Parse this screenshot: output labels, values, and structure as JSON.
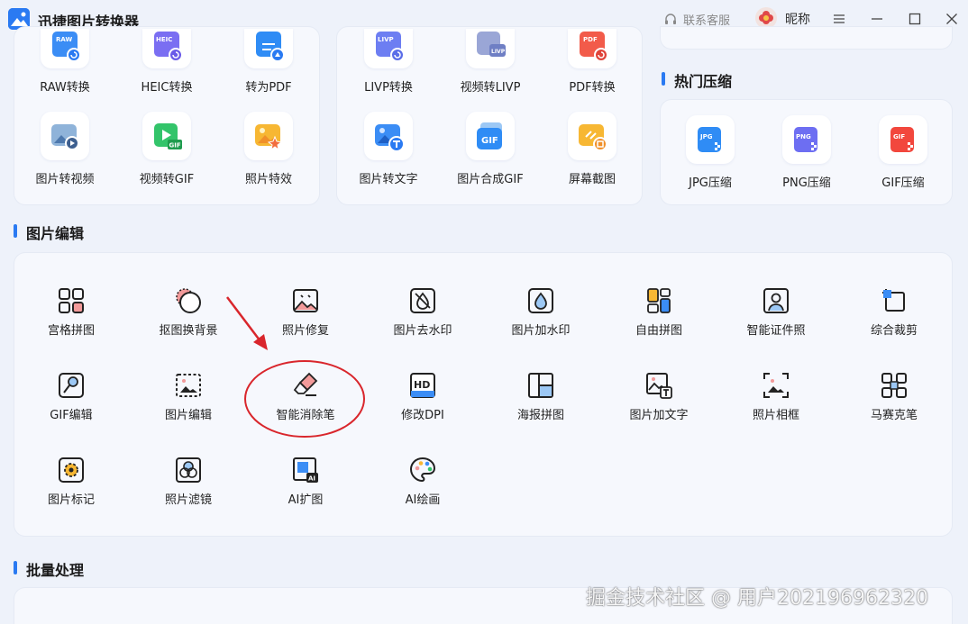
{
  "app": {
    "title": "迅捷图片转换器"
  },
  "header": {
    "support_label": "联系客服",
    "nickname": "昵称"
  },
  "convert_panel_left": {
    "row1": [
      "RAW转换",
      "HEIC转换",
      "转为PDF"
    ],
    "row1_badges": [
      "RAW",
      "HEIC",
      ""
    ],
    "row2": [
      "图片转视频",
      "视频转GIF",
      "照片特效"
    ],
    "row2_badges": [
      "",
      "GIF",
      ""
    ]
  },
  "convert_panel_mid": {
    "row1": [
      "LIVP转换",
      "视频转LIVP",
      "PDF转换"
    ],
    "row1_badges": [
      "LIVP",
      "LIVP",
      "PDF"
    ],
    "row2": [
      "图片转文字",
      "图片合成GIF",
      "屏幕截图"
    ],
    "row2_badges": [
      "",
      "GIF",
      ""
    ]
  },
  "hot_compress": {
    "title": "热门压缩",
    "items": [
      "JPG压缩",
      "PNG压缩",
      "GIF压缩"
    ],
    "badges": [
      "JPG",
      "PNG",
      "GIF"
    ]
  },
  "image_edit": {
    "title": "图片编辑",
    "row1": [
      "宫格拼图",
      "抠图换背景",
      "照片修复",
      "图片去水印",
      "图片加水印",
      "自由拼图",
      "智能证件照",
      "综合裁剪"
    ],
    "row2": [
      "GIF编辑",
      "图片编辑",
      "智能消除笔",
      "修改DPI",
      "海报拼图",
      "图片加文字",
      "照片相框",
      "马赛克笔"
    ],
    "row3": [
      "图片标记",
      "照片滤镜",
      "AI扩图",
      "AI绘画"
    ],
    "badges": {
      "hd": "HD",
      "ai": "AI"
    }
  },
  "batch": {
    "title": "批量处理"
  },
  "watermark": "掘金技术社区 @ 用户202196962320",
  "colors": {
    "accent": "#2a7af2",
    "annotation": "#d9262c",
    "panel_bg": "#f6f8fd",
    "page_bg": "#eef2fa"
  }
}
